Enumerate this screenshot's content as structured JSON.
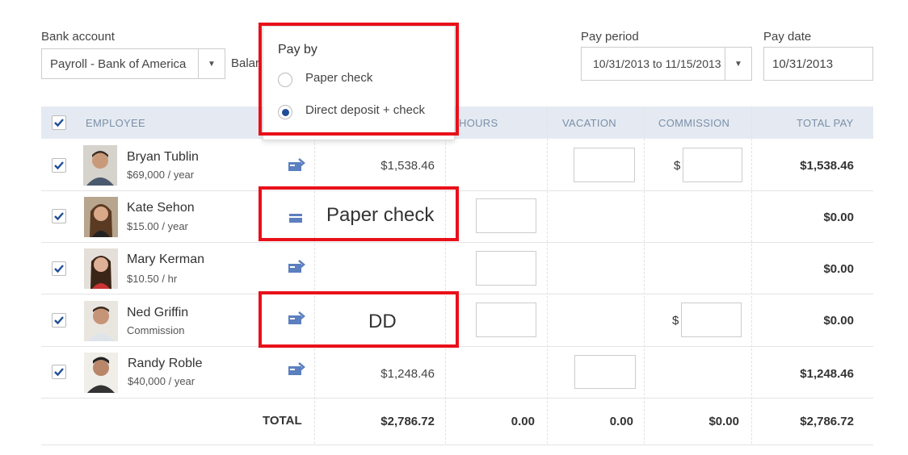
{
  "top": {
    "bank_account_label": "Bank account",
    "bank_account_value": "Payroll - Bank of America",
    "balance_label_partial": "Balar",
    "pay_period_label": "Pay period",
    "pay_period_value": "10/31/2013 to 11/15/2013",
    "pay_date_label": "Pay date",
    "pay_date_value": "10/31/2013"
  },
  "popup": {
    "title": "Pay by",
    "option_paper": "Paper check",
    "option_direct": "Direct deposit + check",
    "selected": "Direct deposit + check"
  },
  "table": {
    "headers": {
      "employee": "EMPLOYEE",
      "hours": "HOURS",
      "vacation": "VACATION",
      "commission": "COMMISSION",
      "total_pay": "TOTAL PAY"
    },
    "rows": [
      {
        "name": "Bryan Tublin",
        "rate": "$69,000 / year",
        "pay_method": "direct-deposit",
        "amount": "$1,538.46",
        "total": "$1,538.46"
      },
      {
        "name": "Kate Sehon",
        "rate": "$15.00 / year",
        "pay_method": "paper-check",
        "amount": "",
        "total": "$0.00"
      },
      {
        "name": "Mary Kerman",
        "rate": "$10.50 / hr",
        "pay_method": "direct-deposit",
        "amount": "",
        "total": "$0.00"
      },
      {
        "name": "Ned Griffin",
        "rate": "Commission",
        "pay_method": "direct-deposit",
        "amount": "",
        "total": "$0.00"
      },
      {
        "name": "Randy Roble",
        "rate": "$40,000 / year",
        "pay_method": "direct-deposit",
        "amount": "$1,248.46",
        "total": "$1,248.46"
      }
    ],
    "totals": {
      "label": "TOTAL",
      "amount": "$2,786.72",
      "hours": "0.00",
      "vacation": "0.00",
      "commission": "$0.00",
      "total_pay": "$2,786.72"
    },
    "currency_symbol": "$"
  },
  "annotations": {
    "paper_check": "Paper check",
    "dd": "DD"
  },
  "colors": {
    "accent": "#1f4e99",
    "header_bg": "#e5eaf2",
    "annotation_red": "#e8101a",
    "icon_blue": "#5b7fbf"
  }
}
